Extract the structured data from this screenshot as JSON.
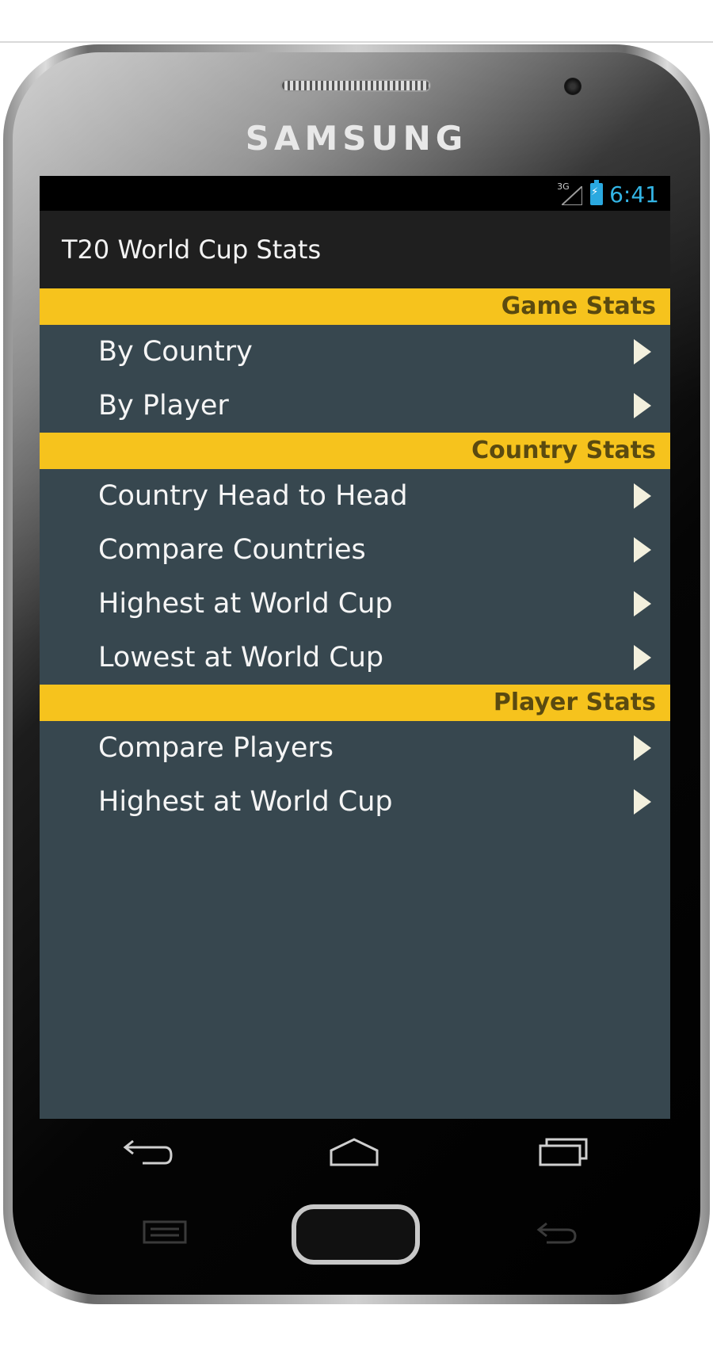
{
  "device": {
    "brand": "SAMSUNG"
  },
  "statusbar": {
    "network": "3G",
    "time": "6:41",
    "icons": [
      "signal-icon",
      "battery-icon"
    ],
    "accent_color": "#33b5e5"
  },
  "app": {
    "title": "T20 World Cup Stats"
  },
  "colors": {
    "section_header_bg": "#f6c31d",
    "section_header_text": "#5a4a10",
    "list_bg": "#37474f",
    "list_text": "#f5f5f5"
  },
  "sections": [
    {
      "header": "Game Stats",
      "items": [
        "By Country",
        "By Player"
      ]
    },
    {
      "header": "Country Stats",
      "items": [
        "Country Head to Head",
        "Compare Countries",
        "Highest at World Cup",
        "Lowest at World Cup"
      ]
    },
    {
      "header": "Player Stats",
      "items": [
        "Compare Players",
        "Highest at World Cup"
      ]
    }
  ],
  "navbar": {
    "icons": [
      "back-icon",
      "home-icon",
      "recent-apps-icon"
    ]
  },
  "hardware_keys": {
    "icons": [
      "menu-icon",
      "home-button",
      "back-icon"
    ]
  }
}
